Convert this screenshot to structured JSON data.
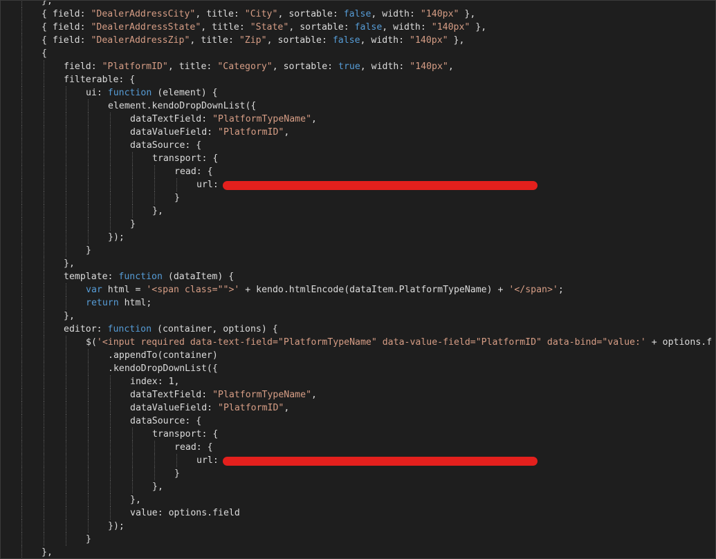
{
  "editor": {
    "language": "javascript",
    "colors": {
      "background": "#1e1e1e",
      "plain": "#dcdcdc",
      "string": "#d69d85",
      "keyword": "#569cd6",
      "indent_guide": "#5a5a5a",
      "redaction": "#e3201d"
    },
    "lines": [
      {
        "indent": 1,
        "tokens": [
          [
            "p",
            "},"
          ]
        ]
      },
      {
        "indent": 1,
        "tokens": [
          [
            "p",
            "{ field: "
          ],
          [
            "s",
            "\"DealerAddressCity\""
          ],
          [
            "p",
            ", title: "
          ],
          [
            "s",
            "\"City\""
          ],
          [
            "p",
            ", sortable: "
          ],
          [
            "k",
            "false"
          ],
          [
            "p",
            ", width: "
          ],
          [
            "s",
            "\"140px\""
          ],
          [
            "p",
            " },"
          ]
        ]
      },
      {
        "indent": 1,
        "tokens": [
          [
            "p",
            "{ field: "
          ],
          [
            "s",
            "\"DealerAddressState\""
          ],
          [
            "p",
            ", title: "
          ],
          [
            "s",
            "\"State\""
          ],
          [
            "p",
            ", sortable: "
          ],
          [
            "k",
            "false"
          ],
          [
            "p",
            ", width: "
          ],
          [
            "s",
            "\"140px\""
          ],
          [
            "p",
            " },"
          ]
        ]
      },
      {
        "indent": 1,
        "tokens": [
          [
            "p",
            "{ field: "
          ],
          [
            "s",
            "\"DealerAddressZip\""
          ],
          [
            "p",
            ", title: "
          ],
          [
            "s",
            "\"Zip\""
          ],
          [
            "p",
            ", sortable: "
          ],
          [
            "k",
            "false"
          ],
          [
            "p",
            ", width: "
          ],
          [
            "s",
            "\"140px\""
          ],
          [
            "p",
            " },"
          ]
        ]
      },
      {
        "indent": 1,
        "tokens": [
          [
            "p",
            "{"
          ]
        ]
      },
      {
        "indent": 2,
        "tokens": [
          [
            "p",
            "field: "
          ],
          [
            "s",
            "\"PlatformID\""
          ],
          [
            "p",
            ", title: "
          ],
          [
            "s",
            "\"Category\""
          ],
          [
            "p",
            ", sortable: "
          ],
          [
            "k",
            "true"
          ],
          [
            "p",
            ", width: "
          ],
          [
            "s",
            "\"140px\""
          ],
          [
            "p",
            ","
          ]
        ]
      },
      {
        "indent": 2,
        "tokens": [
          [
            "p",
            "filterable: {"
          ]
        ]
      },
      {
        "indent": 3,
        "tokens": [
          [
            "p",
            "ui: "
          ],
          [
            "k",
            "function"
          ],
          [
            "p",
            " (element) {"
          ]
        ]
      },
      {
        "indent": 4,
        "tokens": [
          [
            "p",
            "element.kendoDropDownList({"
          ]
        ]
      },
      {
        "indent": 5,
        "tokens": [
          [
            "p",
            "dataTextField: "
          ],
          [
            "s",
            "\"PlatformTypeName\""
          ],
          [
            "p",
            ","
          ]
        ]
      },
      {
        "indent": 5,
        "tokens": [
          [
            "p",
            "dataValueField: "
          ],
          [
            "s",
            "\"PlatformID\""
          ],
          [
            "p",
            ","
          ]
        ]
      },
      {
        "indent": 5,
        "tokens": [
          [
            "p",
            "dataSource: {"
          ]
        ]
      },
      {
        "indent": 6,
        "tokens": [
          [
            "p",
            "transport: {"
          ]
        ]
      },
      {
        "indent": 7,
        "tokens": [
          [
            "p",
            "read: {"
          ]
        ]
      },
      {
        "indent": 8,
        "tokens": [
          [
            "p",
            "url: "
          ]
        ],
        "redacted": true
      },
      {
        "indent": 7,
        "tokens": [
          [
            "p",
            "}"
          ]
        ]
      },
      {
        "indent": 6,
        "tokens": [
          [
            "p",
            "},"
          ]
        ]
      },
      {
        "indent": 5,
        "tokens": [
          [
            "p",
            "}"
          ]
        ]
      },
      {
        "indent": 4,
        "tokens": [
          [
            "p",
            "});"
          ]
        ]
      },
      {
        "indent": 3,
        "tokens": [
          [
            "p",
            "}"
          ]
        ]
      },
      {
        "indent": 2,
        "tokens": [
          [
            "p",
            "},"
          ]
        ]
      },
      {
        "indent": 2,
        "tokens": [
          [
            "p",
            "template: "
          ],
          [
            "k",
            "function"
          ],
          [
            "p",
            " (dataItem) {"
          ]
        ]
      },
      {
        "indent": 3,
        "tokens": [
          [
            "k",
            "var"
          ],
          [
            "p",
            " html = "
          ],
          [
            "s",
            "'<span class=\"\">'"
          ],
          [
            "p",
            " + kendo.htmlEncode(dataItem.PlatformTypeName) + "
          ],
          [
            "s",
            "'</span>'"
          ],
          [
            "p",
            ";"
          ]
        ]
      },
      {
        "indent": 3,
        "tokens": [
          [
            "k",
            "return"
          ],
          [
            "p",
            " html;"
          ]
        ]
      },
      {
        "indent": 2,
        "tokens": [
          [
            "p",
            "},"
          ]
        ]
      },
      {
        "indent": 2,
        "tokens": [
          [
            "p",
            "editor: "
          ],
          [
            "k",
            "function"
          ],
          [
            "p",
            " (container, options) {"
          ]
        ]
      },
      {
        "indent": 3,
        "tokens": [
          [
            "p",
            "$("
          ],
          [
            "s",
            "'<input required data-text-field=\"PlatformTypeName\" data-value-field=\"PlatformID\" data-bind=\"value:'"
          ],
          [
            "p",
            " + options.f"
          ]
        ]
      },
      {
        "indent": 4,
        "tokens": [
          [
            "p",
            ".appendTo(container)"
          ]
        ]
      },
      {
        "indent": 4,
        "tokens": [
          [
            "p",
            ".kendoDropDownList({"
          ]
        ]
      },
      {
        "indent": 5,
        "tokens": [
          [
            "p",
            "index: 1,"
          ]
        ]
      },
      {
        "indent": 5,
        "tokens": [
          [
            "p",
            "dataTextField: "
          ],
          [
            "s",
            "\"PlatformTypeName\""
          ],
          [
            "p",
            ","
          ]
        ]
      },
      {
        "indent": 5,
        "tokens": [
          [
            "p",
            "dataValueField: "
          ],
          [
            "s",
            "\"PlatformID\""
          ],
          [
            "p",
            ","
          ]
        ]
      },
      {
        "indent": 5,
        "tokens": [
          [
            "p",
            "dataSource: {"
          ]
        ]
      },
      {
        "indent": 6,
        "tokens": [
          [
            "p",
            "transport: {"
          ]
        ]
      },
      {
        "indent": 7,
        "tokens": [
          [
            "p",
            "read: {"
          ]
        ]
      },
      {
        "indent": 8,
        "tokens": [
          [
            "p",
            "url: "
          ]
        ],
        "redacted": true
      },
      {
        "indent": 7,
        "tokens": [
          [
            "p",
            "}"
          ]
        ]
      },
      {
        "indent": 6,
        "tokens": [
          [
            "p",
            "},"
          ]
        ]
      },
      {
        "indent": 5,
        "tokens": [
          [
            "p",
            "},"
          ]
        ]
      },
      {
        "indent": 5,
        "tokens": [
          [
            "p",
            "value: options.field"
          ]
        ]
      },
      {
        "indent": 4,
        "tokens": [
          [
            "p",
            "});"
          ]
        ]
      },
      {
        "indent": 3,
        "tokens": [
          [
            "p",
            "}"
          ]
        ]
      },
      {
        "indent": 1,
        "tokens": [
          [
            "p",
            "},"
          ]
        ]
      }
    ]
  }
}
